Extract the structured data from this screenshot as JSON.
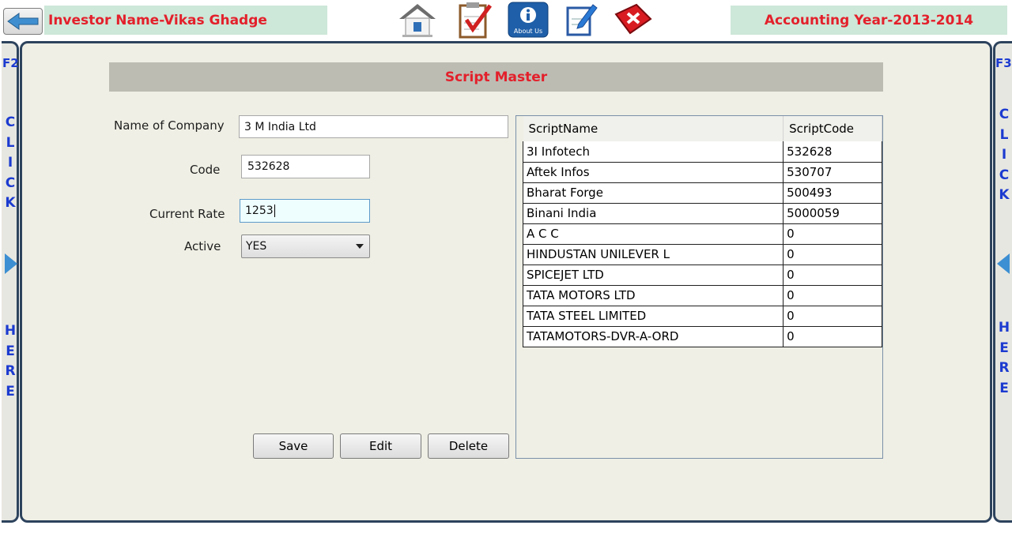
{
  "header": {
    "investor": "Investor Name-Vikas Ghadge",
    "year": "Accounting Year-2013-2014",
    "toolbar": {
      "about_label": "About Us"
    }
  },
  "side_left": {
    "key": "F2",
    "word1": "CLICK",
    "word2": "HERE"
  },
  "side_right": {
    "key": "F3",
    "word1": "CLICK",
    "word2": "HERE"
  },
  "form": {
    "title": "Script Master",
    "company_label": "Name of Company",
    "company_value": "3 M India Ltd",
    "code_label": "Code",
    "code_value": "532628",
    "rate_label": "Current Rate",
    "rate_value": "1253",
    "active_label": "Active",
    "active_value": "YES",
    "save": "Save",
    "edit": "Edit",
    "delete": "Delete"
  },
  "grid": {
    "headers": [
      "ScriptName",
      "ScriptCode"
    ],
    "rows": [
      [
        "3I Infotech",
        "532628"
      ],
      [
        "Aftek Infos",
        "530707"
      ],
      [
        "Bharat Forge",
        "500493"
      ],
      [
        "Binani India",
        "5000059"
      ],
      [
        "A C C",
        "0"
      ],
      [
        "HINDUSTAN UNILEVER L",
        "0"
      ],
      [
        "SPICEJET LTD",
        "0"
      ],
      [
        "TATA MOTORS LTD",
        "0"
      ],
      [
        "TATA STEEL LIMITED",
        "0"
      ],
      [
        "TATAMOTORS-DVR-A-ORD",
        "0"
      ]
    ]
  },
  "colors": {
    "accent_red": "#e3202b",
    "panel_border": "#2d435d",
    "side_text": "#1c3bd0"
  }
}
